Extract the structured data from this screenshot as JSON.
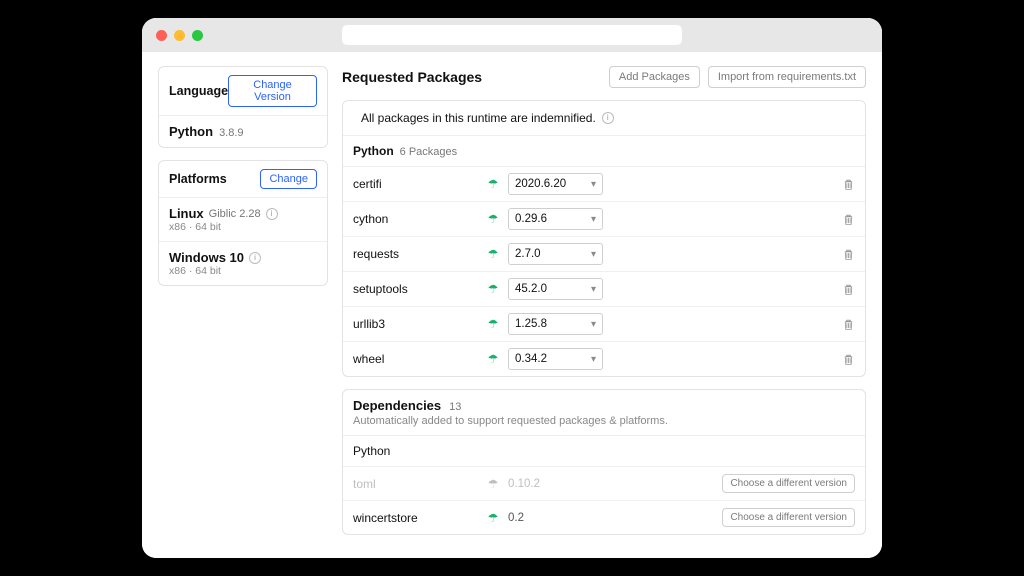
{
  "sidebar": {
    "language": {
      "title": "Language",
      "change_btn": "Change Version",
      "name": "Python",
      "version": "3.8.9"
    },
    "platforms": {
      "title": "Platforms",
      "change_btn": "Change",
      "items": [
        {
          "name": "Linux",
          "detail": "Giblic 2.28",
          "arch": "x86 · 64 bit"
        },
        {
          "name": "Windows 10",
          "detail": "",
          "arch": "x86 · 64 bit"
        }
      ]
    }
  },
  "main": {
    "title": "Requested Packages",
    "add_btn": "Add Packages",
    "import_btn": "Import from requirements.txt",
    "notice": "All packages in this runtime are indemnified.",
    "group": {
      "lang": "Python",
      "count_label": "6 Packages",
      "packages": [
        {
          "name": "certifi",
          "version": "2020.6.20"
        },
        {
          "name": "cython",
          "version": "0.29.6"
        },
        {
          "name": "requests",
          "version": "2.7.0"
        },
        {
          "name": "setuptools",
          "version": "45.2.0"
        },
        {
          "name": "urllib3",
          "version": "1.25.8"
        },
        {
          "name": "wheel",
          "version": "0.34.2"
        }
      ]
    },
    "deps": {
      "title": "Dependencies",
      "count": "13",
      "subtitle": "Automatically added to support requested packages & platforms.",
      "lang_label": "Python",
      "choose_btn": "Choose a different version",
      "items": [
        {
          "name": "toml",
          "version": "0.10.2",
          "disabled": true
        },
        {
          "name": "wincertstore",
          "version": "0.2",
          "disabled": false
        }
      ]
    }
  }
}
